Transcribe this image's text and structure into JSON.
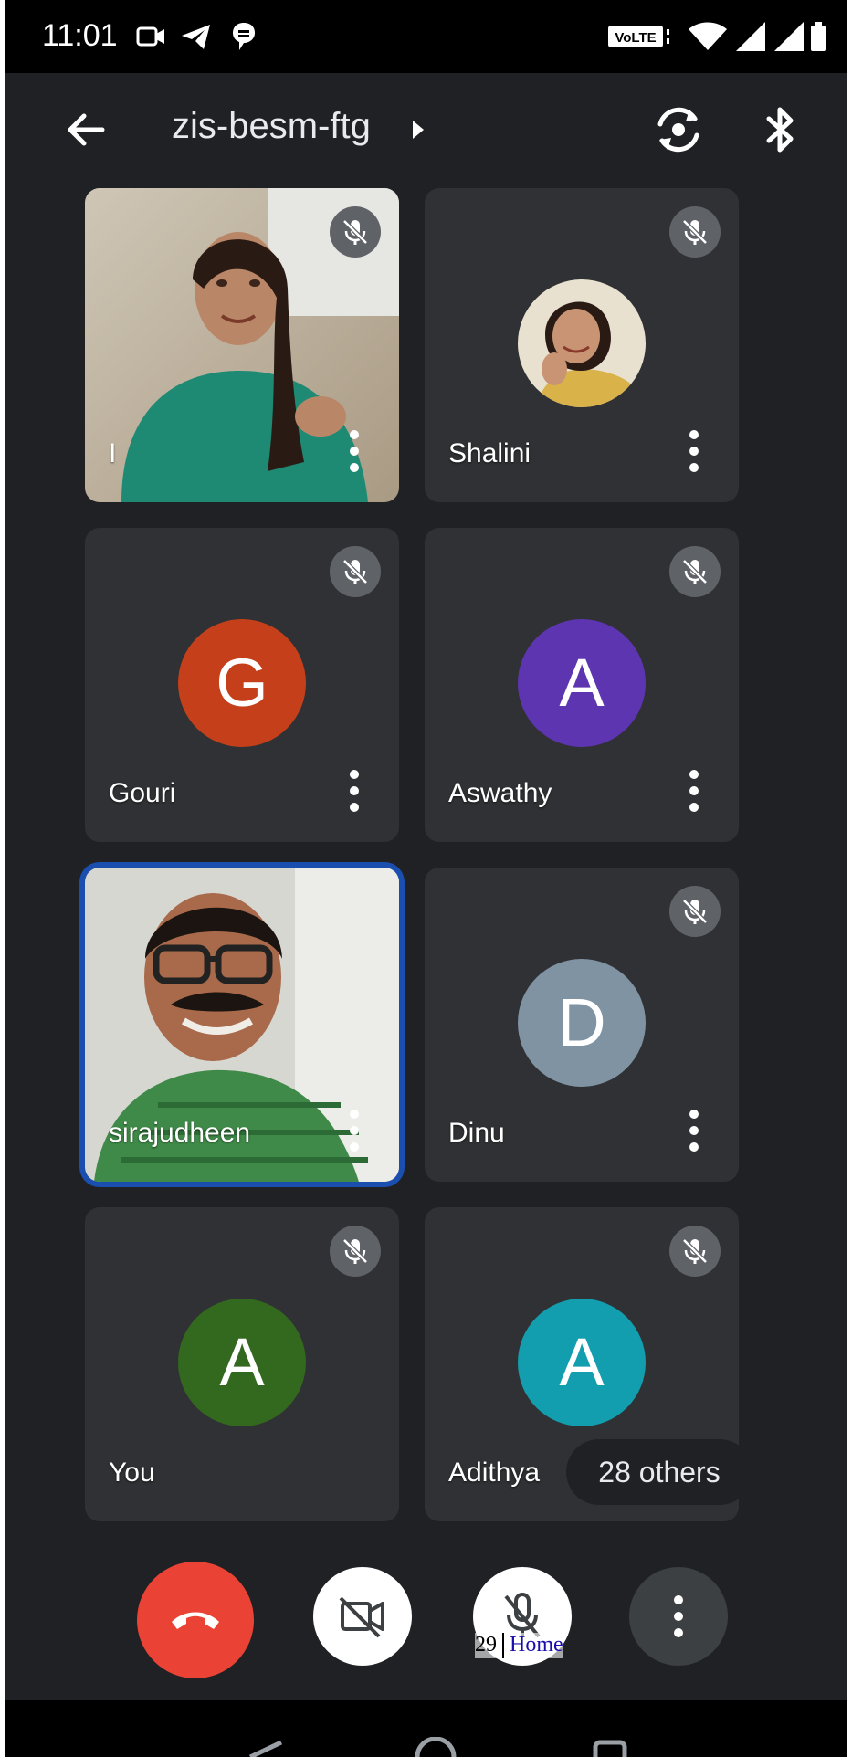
{
  "status_bar": {
    "time": "11:01",
    "volte": "VoLTE"
  },
  "header": {
    "meeting_code": "zis-besm-ftg"
  },
  "participants": [
    {
      "name": "I",
      "avatar_letter": "",
      "avatar_color": "",
      "video": true,
      "muted": true
    },
    {
      "name": "Shalini",
      "avatar_letter": "",
      "avatar_color": "",
      "video": false,
      "photo": true,
      "muted": true
    },
    {
      "name": "Gouri",
      "avatar_letter": "G",
      "avatar_color": "#c5401a",
      "video": false,
      "muted": true
    },
    {
      "name": "Aswathy",
      "avatar_letter": "A",
      "avatar_color": "#5e35b1",
      "video": false,
      "muted": true
    },
    {
      "name": "sirajudheen",
      "avatar_letter": "",
      "avatar_color": "",
      "video": true,
      "muted": false,
      "active_speaker": true
    },
    {
      "name": "Dinu",
      "avatar_letter": "D",
      "avatar_color": "#7f93a3",
      "video": false,
      "muted": true
    },
    {
      "name": "You",
      "avatar_letter": "A",
      "avatar_color": "#33691e",
      "video": false,
      "muted": true
    },
    {
      "name": "Adithya",
      "avatar_letter": "A",
      "avatar_color": "#129eaf",
      "video": false,
      "muted": true
    }
  ],
  "others_chip": "28 others",
  "footer": {
    "page": "29",
    "link": "Home"
  },
  "colors": {
    "end_call": "#ea4335",
    "background": "#202124",
    "tile": "#303134",
    "speaker_border": "#1a4fb0"
  }
}
